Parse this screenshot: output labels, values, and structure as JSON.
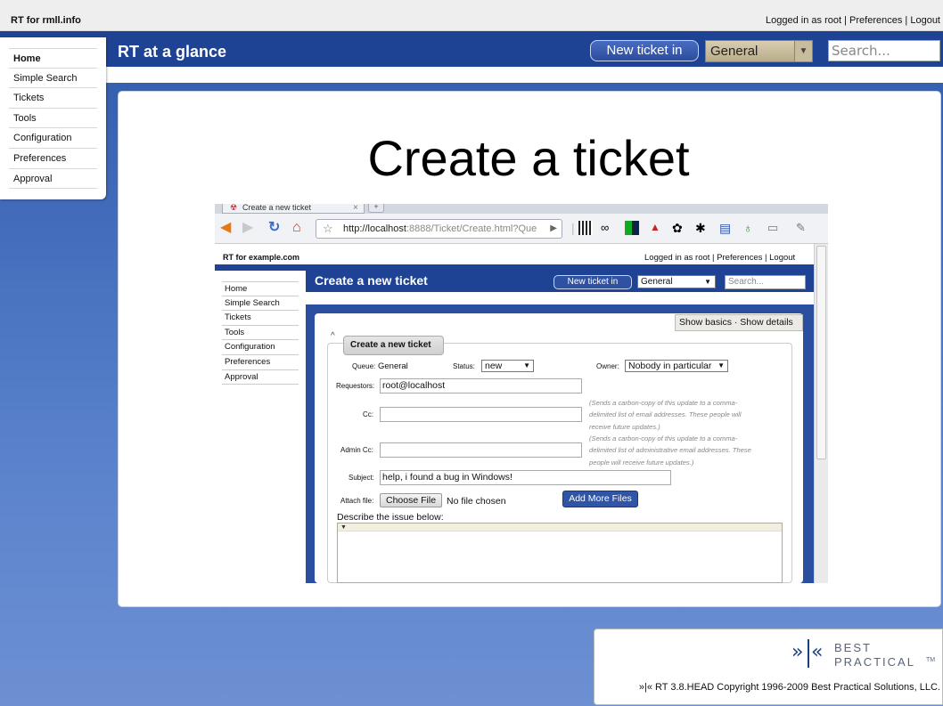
{
  "topbar": {
    "site_name": "RT for rmll.info",
    "logged_in": "Logged in as root",
    "sep1": " | ",
    "preferences": "Preferences",
    "sep2": " | ",
    "logout": "Logout"
  },
  "header": {
    "title": "RT at a glance",
    "new_ticket_label": "New ticket in",
    "queue_value": "General",
    "search_placeholder": "Search..."
  },
  "sidebar": {
    "items": [
      {
        "label": "Home"
      },
      {
        "label": "Simple Search"
      },
      {
        "label": "Tickets"
      },
      {
        "label": "Tools"
      },
      {
        "label": "Configuration"
      },
      {
        "label": "Preferences"
      },
      {
        "label": "Approval"
      }
    ]
  },
  "slide": {
    "title": "Create a ticket"
  },
  "browser": {
    "tab_title": "Create a new ticket",
    "tab_close": "×",
    "url_host": "http://localhost",
    "url_path": ":8888/Ticket/Create.html?Que"
  },
  "inner": {
    "site_name": "RT for example.com",
    "userbar": "Logged in as root | Preferences | Logout",
    "title": "Create a new ticket",
    "new_ticket_label": "New ticket in",
    "queue_value": "General",
    "search_placeholder": "Search...",
    "nav": [
      "Home",
      "Simple Search",
      "Tickets",
      "Tools",
      "Configuration",
      "Preferences",
      "Approval"
    ],
    "show_bar": "Show basics · Show details",
    "box_title": "Create a new ticket",
    "form": {
      "queue_label": "Queue:",
      "queue_value": "General",
      "status_label": "Status:",
      "status_value": "new",
      "owner_label": "Owner:",
      "owner_value": "Nobody in particular",
      "requestors_label": "Requestors:",
      "requestors_value": "root@localhost",
      "cc_label": "Cc:",
      "cc_hint_1": "(Sends a carbon-copy of this update to a comma-",
      "cc_hint_2": "delimited list of email addresses. These people will",
      "cc_hint_3": "receive future updates.)",
      "admincc_label": "Admin Cc:",
      "admincc_hint_1": "(Sends a carbon-copy of this update to a comma-",
      "admincc_hint_2": "delimited list of administrative email addresses. These",
      "admincc_hint_3": "people will receive future updates.)",
      "subject_label": "Subject:",
      "subject_value": "help, i found a bug in Windows!",
      "attach_label": "Attach file:",
      "choose_file": "Choose File",
      "no_file": "No file chosen",
      "add_more": "Add More Files",
      "describe_label": "Describe the issue below:"
    }
  },
  "footer": {
    "logo_line1": "BEST",
    "logo_line2": "PRACTICAL",
    "logo_tm": "TM",
    "copyright": "»|« RT 3.8.HEAD Copyright 1996-2009 Best Practical Solutions, LLC."
  },
  "colors": {
    "header_blue": "#1f4394",
    "background_blue": "#4f74c2",
    "queue_select": "#c7bc9c"
  }
}
